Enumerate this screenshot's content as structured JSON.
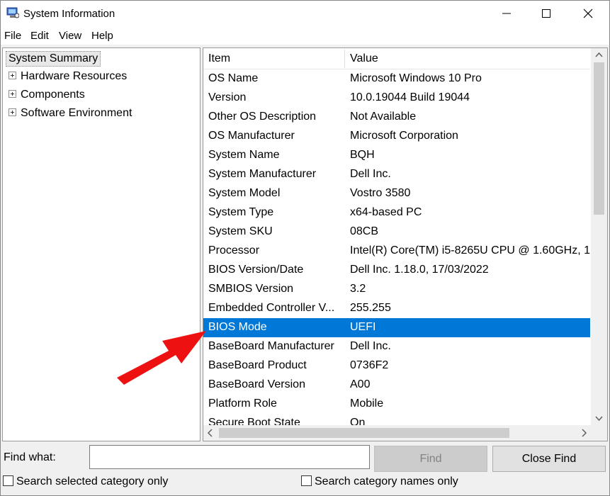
{
  "window": {
    "title": "System Information",
    "accent_color": "#0078d7"
  },
  "menu": {
    "items": [
      "File",
      "Edit",
      "View",
      "Help"
    ]
  },
  "tree": {
    "root": "System Summary",
    "children": [
      "Hardware Resources",
      "Components",
      "Software Environment"
    ]
  },
  "list": {
    "headers": {
      "item": "Item",
      "value": "Value"
    },
    "rows": [
      {
        "item": "OS Name",
        "value": "Microsoft Windows 10 Pro"
      },
      {
        "item": "Version",
        "value": "10.0.19044 Build 19044"
      },
      {
        "item": "Other OS Description",
        "value": "Not Available"
      },
      {
        "item": "OS Manufacturer",
        "value": "Microsoft Corporation"
      },
      {
        "item": "System Name",
        "value": "BQH"
      },
      {
        "item": "System Manufacturer",
        "value": "Dell Inc."
      },
      {
        "item": "System Model",
        "value": "Vostro 3580"
      },
      {
        "item": "System Type",
        "value": "x64-based PC"
      },
      {
        "item": "System SKU",
        "value": "08CB"
      },
      {
        "item": "Processor",
        "value": "Intel(R) Core(TM) i5-8265U CPU @ 1.60GHz, 1"
      },
      {
        "item": "BIOS Version/Date",
        "value": "Dell Inc. 1.18.0, 17/03/2022"
      },
      {
        "item": "SMBIOS Version",
        "value": "3.2"
      },
      {
        "item": "Embedded Controller V...",
        "value": "255.255"
      },
      {
        "item": "BIOS Mode",
        "value": "UEFI",
        "selected": true
      },
      {
        "item": "BaseBoard Manufacturer",
        "value": "Dell Inc."
      },
      {
        "item": "BaseBoard Product",
        "value": "0736F2"
      },
      {
        "item": "BaseBoard Version",
        "value": "A00"
      },
      {
        "item": "Platform Role",
        "value": "Mobile"
      },
      {
        "item": "Secure Boot State",
        "value": "On"
      }
    ]
  },
  "find": {
    "label": "Find what:",
    "value": "",
    "find_button": "Find",
    "close_button": "Close Find",
    "check_selected": "Search selected category only",
    "check_names": "Search category names only"
  },
  "annotation": {
    "color": "#ee1111",
    "icon": "red-arrow-icon"
  }
}
